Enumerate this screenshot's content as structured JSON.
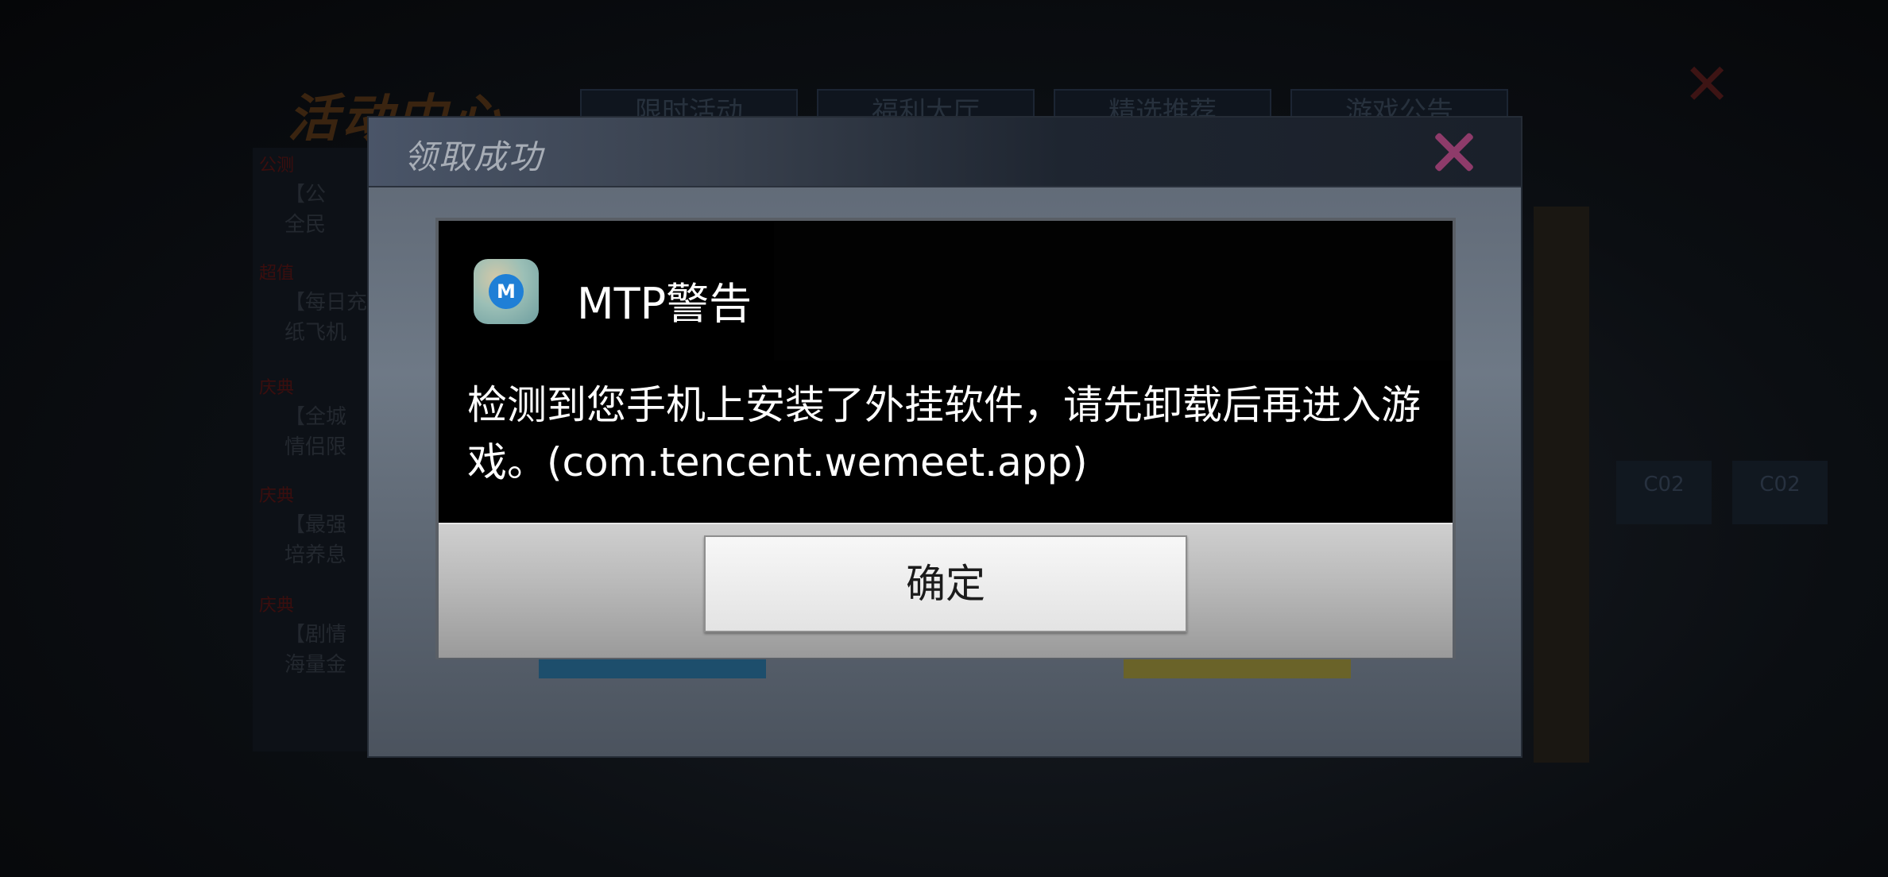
{
  "background": {
    "page_title": "活动中心",
    "tabs": [
      "限时活动",
      "福利大厅",
      "精选推荐",
      "游戏公告"
    ],
    "list": [
      {
        "badge": "公测",
        "line1": "【公",
        "line2": "全民"
      },
      {
        "badge": "超值",
        "line1": "【每日充",
        "line2": "纸飞机"
      },
      {
        "badge": "庆典",
        "line1": "【全城",
        "line2": "情侣限"
      },
      {
        "badge": "庆典",
        "line1": "【最强",
        "line2": "培养息"
      },
      {
        "badge": "庆典",
        "line1": "【剧情",
        "line2": "海量金"
      }
    ],
    "crates": [
      "C02",
      "C02"
    ]
  },
  "game_dialog": {
    "title": "领取成功"
  },
  "mtp_dialog": {
    "title": "MTP警告",
    "message": "检测到您手机上安装了外挂软件，请先卸载后再进入游戏。(com.tencent.wemeet.app)",
    "ok_label": "确定",
    "icon_glyph": "M"
  },
  "colors": {
    "dialog_bg": "#000000",
    "footer_bg": "#b9b9b9",
    "close_x": "#8e3b6a"
  }
}
